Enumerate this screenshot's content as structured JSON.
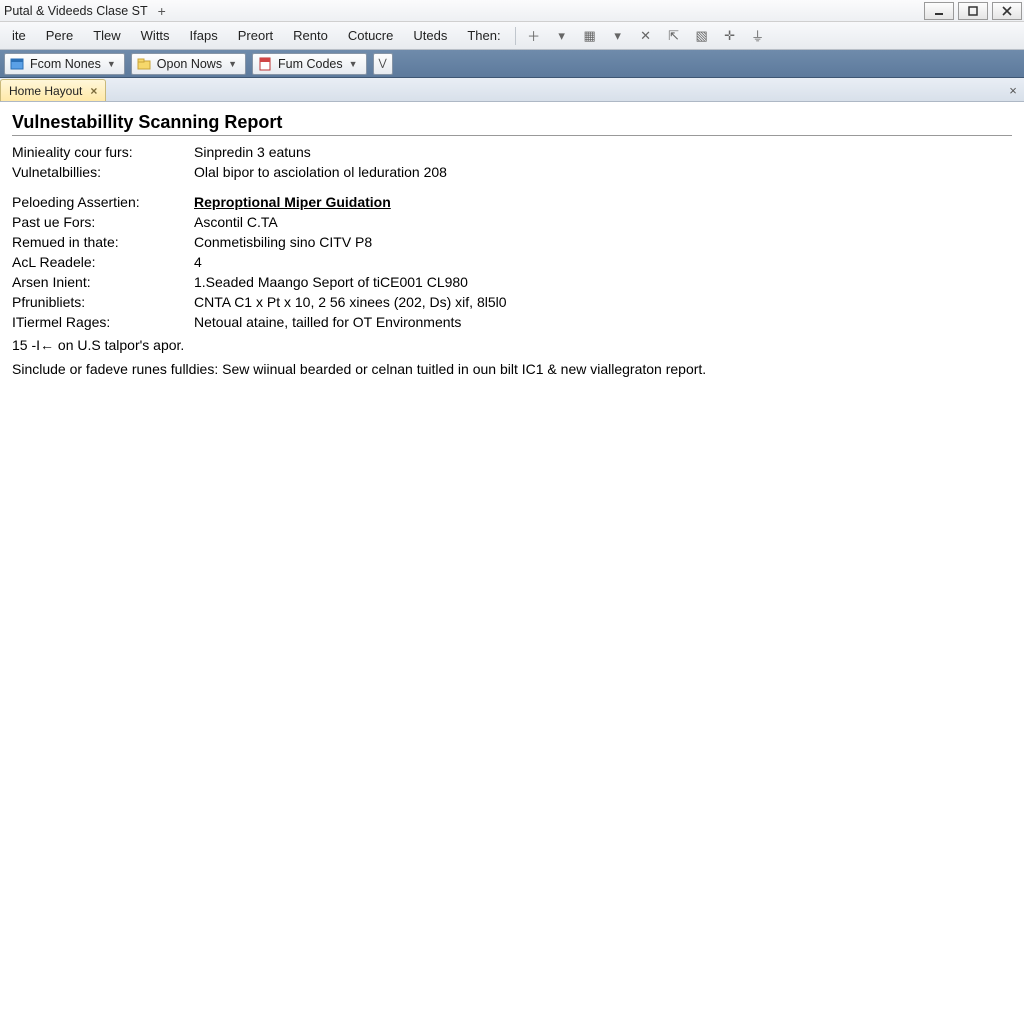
{
  "window": {
    "title": "Putal & Videeds Clase ST"
  },
  "menus": [
    "ite",
    "Pere",
    "Tlew",
    "Witts",
    "Ifaps",
    "Preort",
    "Rento",
    "Cotucre",
    "Uteds",
    "Then:"
  ],
  "ribbon": {
    "btn1": "Fcom Nones",
    "btn2": "Opon Nows",
    "btn3": "Fum Codes"
  },
  "tab": {
    "label": "Home Hayout"
  },
  "report": {
    "title": "Vulnestabillity Scanning Report",
    "rows": [
      {
        "label": "Minieality cour furs:",
        "value": "Sinpredin 3 eatuns"
      },
      {
        "label": "Vulnetalbillies:",
        "value": "Olal bipor to asciolation ol leduration 208"
      }
    ],
    "rows2": [
      {
        "label": "Peloeding Assertien:",
        "value": "Reproptional Miper Guidation",
        "link": true
      },
      {
        "label": "Past ue Fors:",
        "value": "Ascontil C.TA"
      },
      {
        "label": "Remued in thate:",
        "value": "Conmetisbiling sino CITV P8"
      },
      {
        "label": "AcL Readele:",
        "value": "4"
      },
      {
        "label": "Arsen Inient:",
        "value": "1.Seaded Maango Seport of tiCE001 CL980"
      },
      {
        "label": "Pfrunibliets:",
        "value": "CNTA C1 x Pt x 10, 2 56 xinees  (202,  Ds)  xif, 8l5l0"
      },
      {
        "label": "ITiermel Rages:",
        "value": "Netoual ataine, tailled for OT Environments"
      }
    ],
    "line1": "15 -I← on U.S talpor's apor.",
    "line2": "Sinclude or fadeve runes fulldies: Sew wiinual bearded or celnan tuitled in oun bilt IC1 & new viallegraton report."
  }
}
